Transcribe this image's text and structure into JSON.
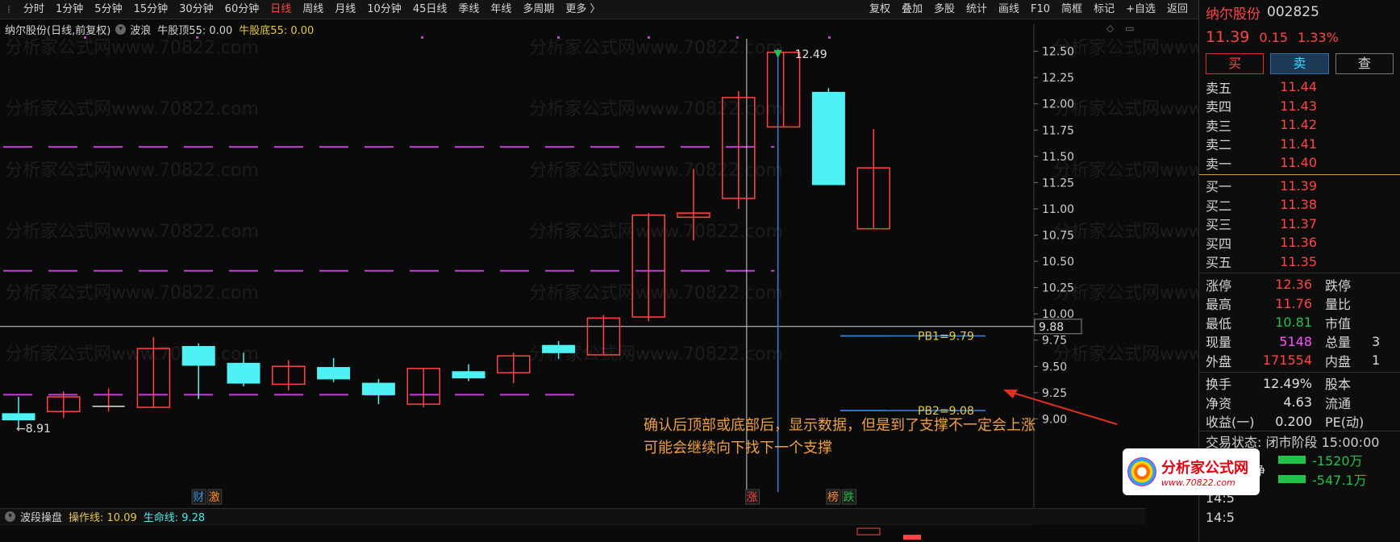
{
  "toolbar": {
    "periods": [
      "分时",
      "1分钟",
      "5分钟",
      "15分钟",
      "30分钟",
      "60分钟",
      "日线",
      "周线",
      "月线",
      "10分钟",
      "45日线",
      "季线",
      "年线",
      "多周期",
      "更多 〉"
    ],
    "active_period": "日线",
    "tools": [
      "复权",
      "叠加",
      "多股",
      "统计",
      "画线",
      "F10",
      "简框",
      "标记",
      "+自选",
      "返回"
    ]
  },
  "info": {
    "stock_label": "纳尔股份(日线,前复权)",
    "indicator": "波浪",
    "top_line": "牛股顶55: 0.00",
    "bottom_line": "牛股底55: 0.00"
  },
  "sub_indicator": {
    "name": "波段操盘",
    "op_line": "操作线: 10.09",
    "life_line": "生命线: 9.28"
  },
  "chart_data": {
    "type": "candlestick",
    "ylim": [
      8.78,
      12.62
    ],
    "y_ticks": [
      "12.50",
      "12.25",
      "12.00",
      "11.75",
      "11.50",
      "11.25",
      "11.00",
      "10.75",
      "10.50",
      "10.25",
      "10.00",
      "9.75",
      "9.50",
      "9.25",
      "9.00"
    ],
    "crosshair_price": "9.88",
    "candles": [
      {
        "o": 9.05,
        "h": 9.21,
        "l": 8.92,
        "c": 8.99
      },
      {
        "o": 9.07,
        "h": 9.26,
        "l": 9.01,
        "c": 9.21
      },
      {
        "o": 9.12,
        "h": 9.29,
        "l": 9.07,
        "c": 9.12
      },
      {
        "o": 9.11,
        "h": 9.78,
        "l": 9.11,
        "c": 9.67
      },
      {
        "o": 9.69,
        "h": 9.72,
        "l": 9.19,
        "c": 9.51
      },
      {
        "o": 9.53,
        "h": 9.63,
        "l": 9.31,
        "c": 9.34
      },
      {
        "o": 9.33,
        "h": 9.56,
        "l": 9.27,
        "c": 9.5
      },
      {
        "o": 9.49,
        "h": 9.58,
        "l": 9.35,
        "c": 9.38
      },
      {
        "o": 9.34,
        "h": 9.38,
        "l": 9.14,
        "c": 9.23
      },
      {
        "o": 9.14,
        "h": 9.48,
        "l": 9.11,
        "c": 9.48
      },
      {
        "o": 9.45,
        "h": 9.52,
        "l": 9.36,
        "c": 9.39
      },
      {
        "o": 9.44,
        "h": 9.63,
        "l": 9.34,
        "c": 9.6
      },
      {
        "o": 9.7,
        "h": 9.74,
        "l": 9.57,
        "c": 9.63
      },
      {
        "o": 9.61,
        "h": 9.99,
        "l": 9.61,
        "c": 9.96
      },
      {
        "o": 9.97,
        "h": 10.96,
        "l": 9.93,
        "c": 10.94
      },
      {
        "o": 10.92,
        "h": 11.38,
        "l": 10.7,
        "c": 10.96
      },
      {
        "o": 11.1,
        "h": 12.12,
        "l": 11.0,
        "c": 12.06
      },
      {
        "o": 11.78,
        "h": 12.49,
        "l": 11.78,
        "c": 12.49
      },
      {
        "o": 12.11,
        "h": 12.15,
        "l": 11.23,
        "c": 11.23
      },
      {
        "o": 10.81,
        "h": 11.76,
        "l": 10.81,
        "c": 11.39
      }
    ],
    "dashed_levels": [
      {
        "y": 11.59,
        "x_end_index": 16.8
      },
      {
        "y": 10.41,
        "x_end_index": 16.8
      },
      {
        "y": 9.23,
        "x_end_index": 12.6
      }
    ],
    "high_label": "12.49",
    "low_label": "←8.91",
    "pb1": {
      "label": "PB1=9.79",
      "y": 9.79
    },
    "pb2": {
      "label": "PB2=9.08",
      "y": 9.08
    },
    "annotation_lines": [
      "确认后顶部或底部后，显示数据，但是到了支撑不一定会上涨",
      "可能会继续向下找下一个支撑"
    ],
    "event_tags": [
      {
        "text": "财",
        "index": 4,
        "color": "#3b8ddd"
      },
      {
        "text": "激",
        "index": 4.35,
        "color": "#ff8a2a"
      },
      {
        "text": "涨",
        "index": 16.3,
        "color": "#ff4545"
      },
      {
        "text": "榜",
        "index": 18.1,
        "color": "#ff8a2a"
      },
      {
        "text": "跌",
        "index": 18.45,
        "color": "#21c24a"
      }
    ],
    "colors": {
      "up": "#ff4545",
      "down": "#4ef2f5",
      "dashed": "#c040d0",
      "annotation": "#f0a040"
    }
  },
  "panel": {
    "name": "纳尔股份",
    "code": "002825",
    "price": "11.39",
    "change": "0.15",
    "pct": "1.33%",
    "buttons": [
      "买",
      "卖",
      "查"
    ],
    "asks": [
      {
        "label": "卖五",
        "price": "11.44"
      },
      {
        "label": "卖四",
        "price": "11.43"
      },
      {
        "label": "卖三",
        "price": "11.42"
      },
      {
        "label": "卖二",
        "price": "11.41"
      },
      {
        "label": "卖一",
        "price": "11.40"
      }
    ],
    "bids": [
      {
        "label": "买一",
        "price": "11.39"
      },
      {
        "label": "买二",
        "price": "11.38"
      },
      {
        "label": "买三",
        "price": "11.37"
      },
      {
        "label": "买四",
        "price": "11.36"
      },
      {
        "label": "买五",
        "price": "11.35"
      }
    ],
    "stats1": [
      {
        "k": "涨停",
        "v": "12.36",
        "c": "red",
        "k2": "跌停",
        "v2": ""
      },
      {
        "k": "最高",
        "v": "11.76",
        "c": "red",
        "k2": "量比",
        "v2": ""
      },
      {
        "k": "最低",
        "v": "10.81",
        "c": "green",
        "k2": "市值",
        "v2": ""
      },
      {
        "k": "现量",
        "v": "5148",
        "c": "magenta",
        "k2": "总量",
        "v2": "3"
      },
      {
        "k": "外盘",
        "v": "171554",
        "c": "red",
        "k2": "内盘",
        "v2": "1"
      }
    ],
    "stats2": [
      {
        "k": "换手",
        "v": "12.49%",
        "c": "white",
        "k2": "股本",
        "v2": ""
      },
      {
        "k": "净资",
        "v": "4.63",
        "c": "white",
        "k2": "流通",
        "v2": ""
      },
      {
        "k": "收益(一)",
        "v": "0.200",
        "c": "white",
        "k2": "PE(动)",
        "v2": ""
      }
    ],
    "state": "交易状态: 闭市阶段 15:00:00",
    "flow1_label": "主力净额",
    "flow1_value": "-1520万",
    "flow2_label": "5日主力净额",
    "flow2_value": "-547.1万",
    "times": [
      "14:5",
      "14:5"
    ]
  },
  "logo": {
    "main": "分析家公式网",
    "sub": "www.70822.com"
  },
  "watermark": "分析家公式网www.70822.com"
}
